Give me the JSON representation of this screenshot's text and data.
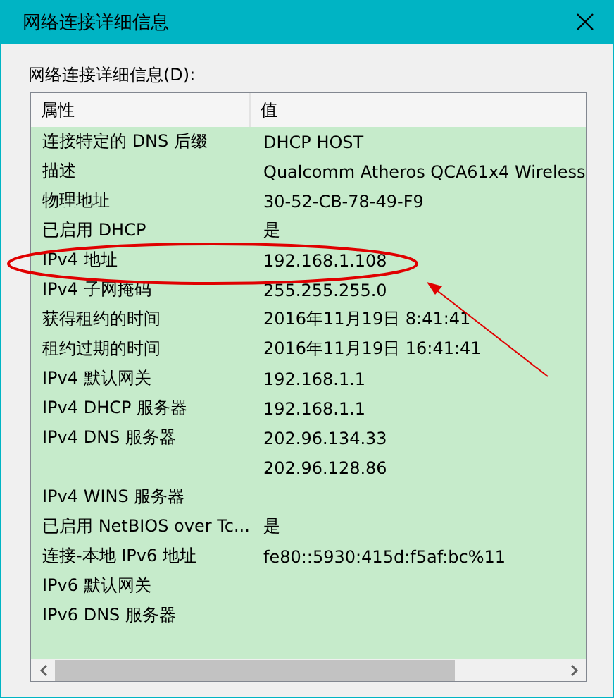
{
  "window": {
    "title": "网络连接详细信息"
  },
  "label": "网络连接详细信息(D):",
  "table": {
    "columns": [
      "属性",
      "值"
    ],
    "rows": [
      {
        "property": "连接特定的 DNS 后缀",
        "value": "DHCP HOST"
      },
      {
        "property": "描述",
        "value": "Qualcomm Atheros QCA61x4 Wireless"
      },
      {
        "property": "物理地址",
        "value": "30-52-CB-78-49-F9"
      },
      {
        "property": "已启用 DHCP",
        "value": "是"
      },
      {
        "property": "IPv4 地址",
        "value": "192.168.1.108"
      },
      {
        "property": "IPv4 子网掩码",
        "value": "255.255.255.0"
      },
      {
        "property": "获得租约的时间",
        "value": "2016年11月19日 8:41:41"
      },
      {
        "property": "租约过期的时间",
        "value": "2016年11月19日 16:41:41"
      },
      {
        "property": "IPv4 默认网关",
        "value": "192.168.1.1"
      },
      {
        "property": "IPv4 DHCP 服务器",
        "value": "192.168.1.1"
      },
      {
        "property": "IPv4 DNS 服务器",
        "value": "202.96.134.33"
      },
      {
        "value": "202.96.128.86"
      },
      {
        "property": "IPv4 WINS 服务器"
      },
      {
        "property": "已启用 NetBIOS over Tc...",
        "value": "是"
      },
      {
        "property": "连接-本地 IPv6 地址",
        "value": "fe80::5930:415d:f5af:bc%11"
      },
      {
        "property": "IPv6 默认网关"
      },
      {
        "property": "IPv6 DNS 服务器"
      }
    ]
  }
}
